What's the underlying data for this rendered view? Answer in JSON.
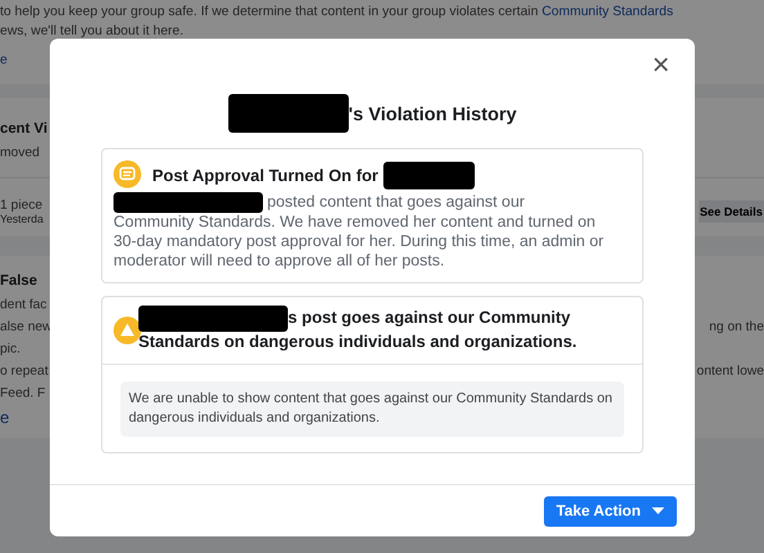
{
  "background_page": {
    "intro": {
      "text": "to help you keep your group safe. If we determine that content in your group violates certain ",
      "link": "Community Standards",
      "line2": "ews, we'll tell you about it here.",
      "more_link": "e"
    },
    "recent_section": {
      "title": "cent Vi",
      "subtitle": "moved",
      "item_title": "1 piece",
      "item_time": "Yesterda",
      "action": "See Details"
    },
    "false_news_section": {
      "title": "False",
      "lines": [
        {
          "left": "dent fac"
        },
        {
          "left": "alse new",
          "right": "ng on the"
        },
        {
          "left": "pic."
        },
        {
          "left": "o repeat",
          "right": "ontent lowe"
        },
        {
          "left": "Feed. F"
        }
      ],
      "more_link": "e"
    }
  },
  "dialog": {
    "close": "×",
    "title": "'s Violation History",
    "cards": [
      {
        "kind": "post_approval",
        "title": "Post Approval Turned On for",
        "body": "posted content that goes against our Community Standards. We have removed her content and turned on 30-day mandatory post approval for her. During this time, an admin or moderator will need to approve all of her posts."
      },
      {
        "kind": "violation",
        "title": "s post goes against our Community Standards on dangerous individuals and organizations.",
        "detail": "We are unable to show content that goes against our Community Standards on dangerous individuals and organizations."
      }
    ],
    "action_button": "Take Action"
  }
}
